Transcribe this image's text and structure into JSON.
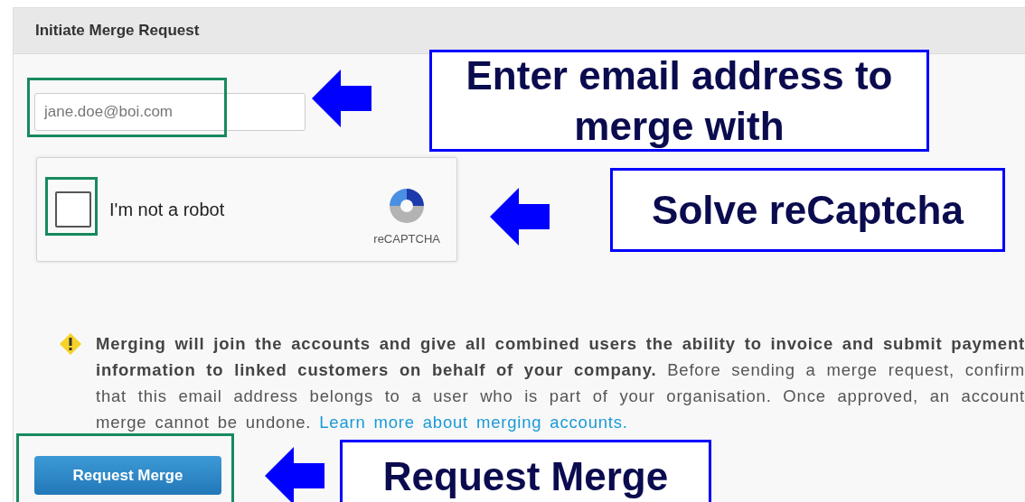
{
  "panel": {
    "title": "Initiate Merge Request"
  },
  "email_field": {
    "value": "jane.doe@boi.com"
  },
  "captcha": {
    "label": "I'm not a robot",
    "checked": false,
    "brand": "reCAPTCHA"
  },
  "warning": {
    "text": "**Merging will join the accounts and give all combined users the ability to invoice and submit payment information to linked customers on behalf of your company.** Before sending a merge request, confirm that this email address belongs to a user who is part of your organisation. Once approved, an account merge cannot be undone.",
    "link": "Learn more about merging accounts."
  },
  "submit_button": {
    "label": "Request Merge"
  },
  "annotations": [
    {
      "kind": "callout",
      "text": "Enter email address to merge with"
    },
    {
      "kind": "callout",
      "text": "Solve reCaptcha"
    },
    {
      "kind": "callout",
      "text": "Request Merge"
    }
  ]
}
